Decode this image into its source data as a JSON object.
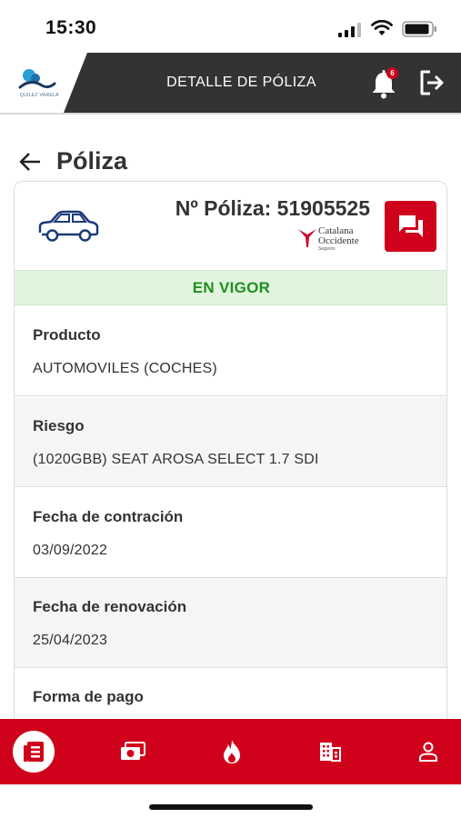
{
  "status_bar": {
    "time": "15:30"
  },
  "header": {
    "title": "DETALLE DE PÓLIZA",
    "logo_text": "QUILEZ VARELA",
    "notification_count": "6",
    "icons": {
      "bell": "bell-icon",
      "logout": "logout-icon"
    }
  },
  "page": {
    "title": "Póliza"
  },
  "policy": {
    "number_label": "Nº Póliza: 51905525",
    "insurer_name_line1": "Catalana",
    "insurer_name_line2": "Occidente",
    "insurer_sub": "Seguros",
    "status": "EN VIGOR",
    "fields": [
      {
        "label": "Producto",
        "value": "AUTOMOVILES (COCHES)"
      },
      {
        "label": "Riesgo",
        "value": "(1020GBB) SEAT AROSA SELECT 1.7 SDI"
      },
      {
        "label": "Fecha de contración",
        "value": "03/09/2022"
      },
      {
        "label": "Fecha de renovación",
        "value": "25/04/2023"
      },
      {
        "label": "Forma de pago",
        "value": ""
      }
    ]
  },
  "tabs": [
    {
      "icon": "policies-icon",
      "active": true
    },
    {
      "icon": "money-icon",
      "active": false
    },
    {
      "icon": "fire-icon",
      "active": false
    },
    {
      "icon": "building-icon",
      "active": false
    },
    {
      "icon": "user-icon",
      "active": false
    }
  ],
  "colors": {
    "brand_red": "#d0021b",
    "header_dark": "#333333",
    "status_green": "#1e8f1e",
    "status_bg": "#e1f5de"
  }
}
